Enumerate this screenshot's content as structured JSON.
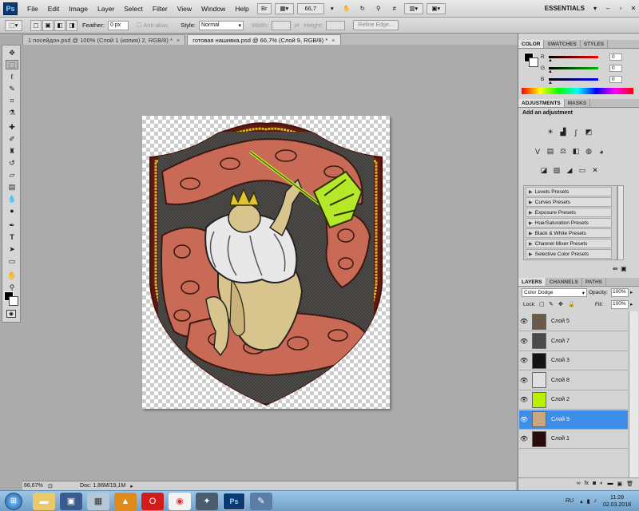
{
  "menubar": {
    "app_logo": "Ps",
    "items": [
      "File",
      "Edit",
      "Image",
      "Layer",
      "Select",
      "Filter",
      "View",
      "Window",
      "Help"
    ],
    "zoom_value": "66,7",
    "workspace": "ESSENTIALS"
  },
  "options": {
    "feather_label": "Feather:",
    "feather_value": "0 px",
    "antialias_label": "Anti-alias",
    "style_label": "Style:",
    "style_value": "Normal",
    "width_label": "Width:",
    "height_label": "Height:",
    "refine_edge": "Refine Edge..."
  },
  "tabs": [
    {
      "label": "1 посейдон.psd @ 100% (Слой 1 (копия) 2, RGB/8) *",
      "close": "×"
    },
    {
      "label": "готовая нашивка.psd @ 66,7% (Слой 9, RGB/8) *",
      "close": "×"
    }
  ],
  "status": {
    "zoom": "66,67%",
    "doc": "Doc: 1,86M/19,1M"
  },
  "color_panel": {
    "tabs": [
      "COLOR",
      "SWATCHES",
      "STYLES"
    ],
    "channels": [
      {
        "label": "R",
        "value": "0",
        "color": "#d02020"
      },
      {
        "label": "G",
        "value": "0",
        "color": "#20a020"
      },
      {
        "label": "B",
        "value": "0",
        "color": "#2020c0"
      }
    ]
  },
  "adjustments": {
    "tabs": [
      "ADJUSTMENTS",
      "MASKS"
    ],
    "heading": "Add an adjustment",
    "presets": [
      "Levels Presets",
      "Curves Presets",
      "Exposure Presets",
      "Hue/Saturation Presets",
      "Black & White Presets",
      "Channel Mixer Presets",
      "Selective Color Presets"
    ]
  },
  "layers_panel": {
    "tabs": [
      "LAYERS",
      "CHANNELS",
      "PATHS"
    ],
    "blend_mode": "Color Dodge",
    "opacity_label": "Opacity:",
    "opacity_value": "100%",
    "lock_label": "Lock:",
    "fill_label": "Fill:",
    "fill_value": "100%",
    "layers": [
      {
        "name": "Слой 5",
        "thumb": "#6b5a48",
        "selected": false
      },
      {
        "name": "Слой 7",
        "thumb": "#4a4a4a",
        "selected": false
      },
      {
        "name": "Слой 3",
        "thumb": "#141414",
        "selected": false
      },
      {
        "name": "Слой 8",
        "thumb": "#e0e0e0",
        "selected": false
      },
      {
        "name": "Слой 2",
        "thumb": "#b8f000",
        "selected": false
      },
      {
        "name": "Слой 9",
        "thumb": "#c8a880",
        "selected": true
      },
      {
        "name": "Слой 1",
        "thumb": "#2a0d0a",
        "selected": false
      }
    ]
  },
  "taskbar": {
    "lang": "RU",
    "time": "11:28",
    "date": "02.03.2018"
  }
}
